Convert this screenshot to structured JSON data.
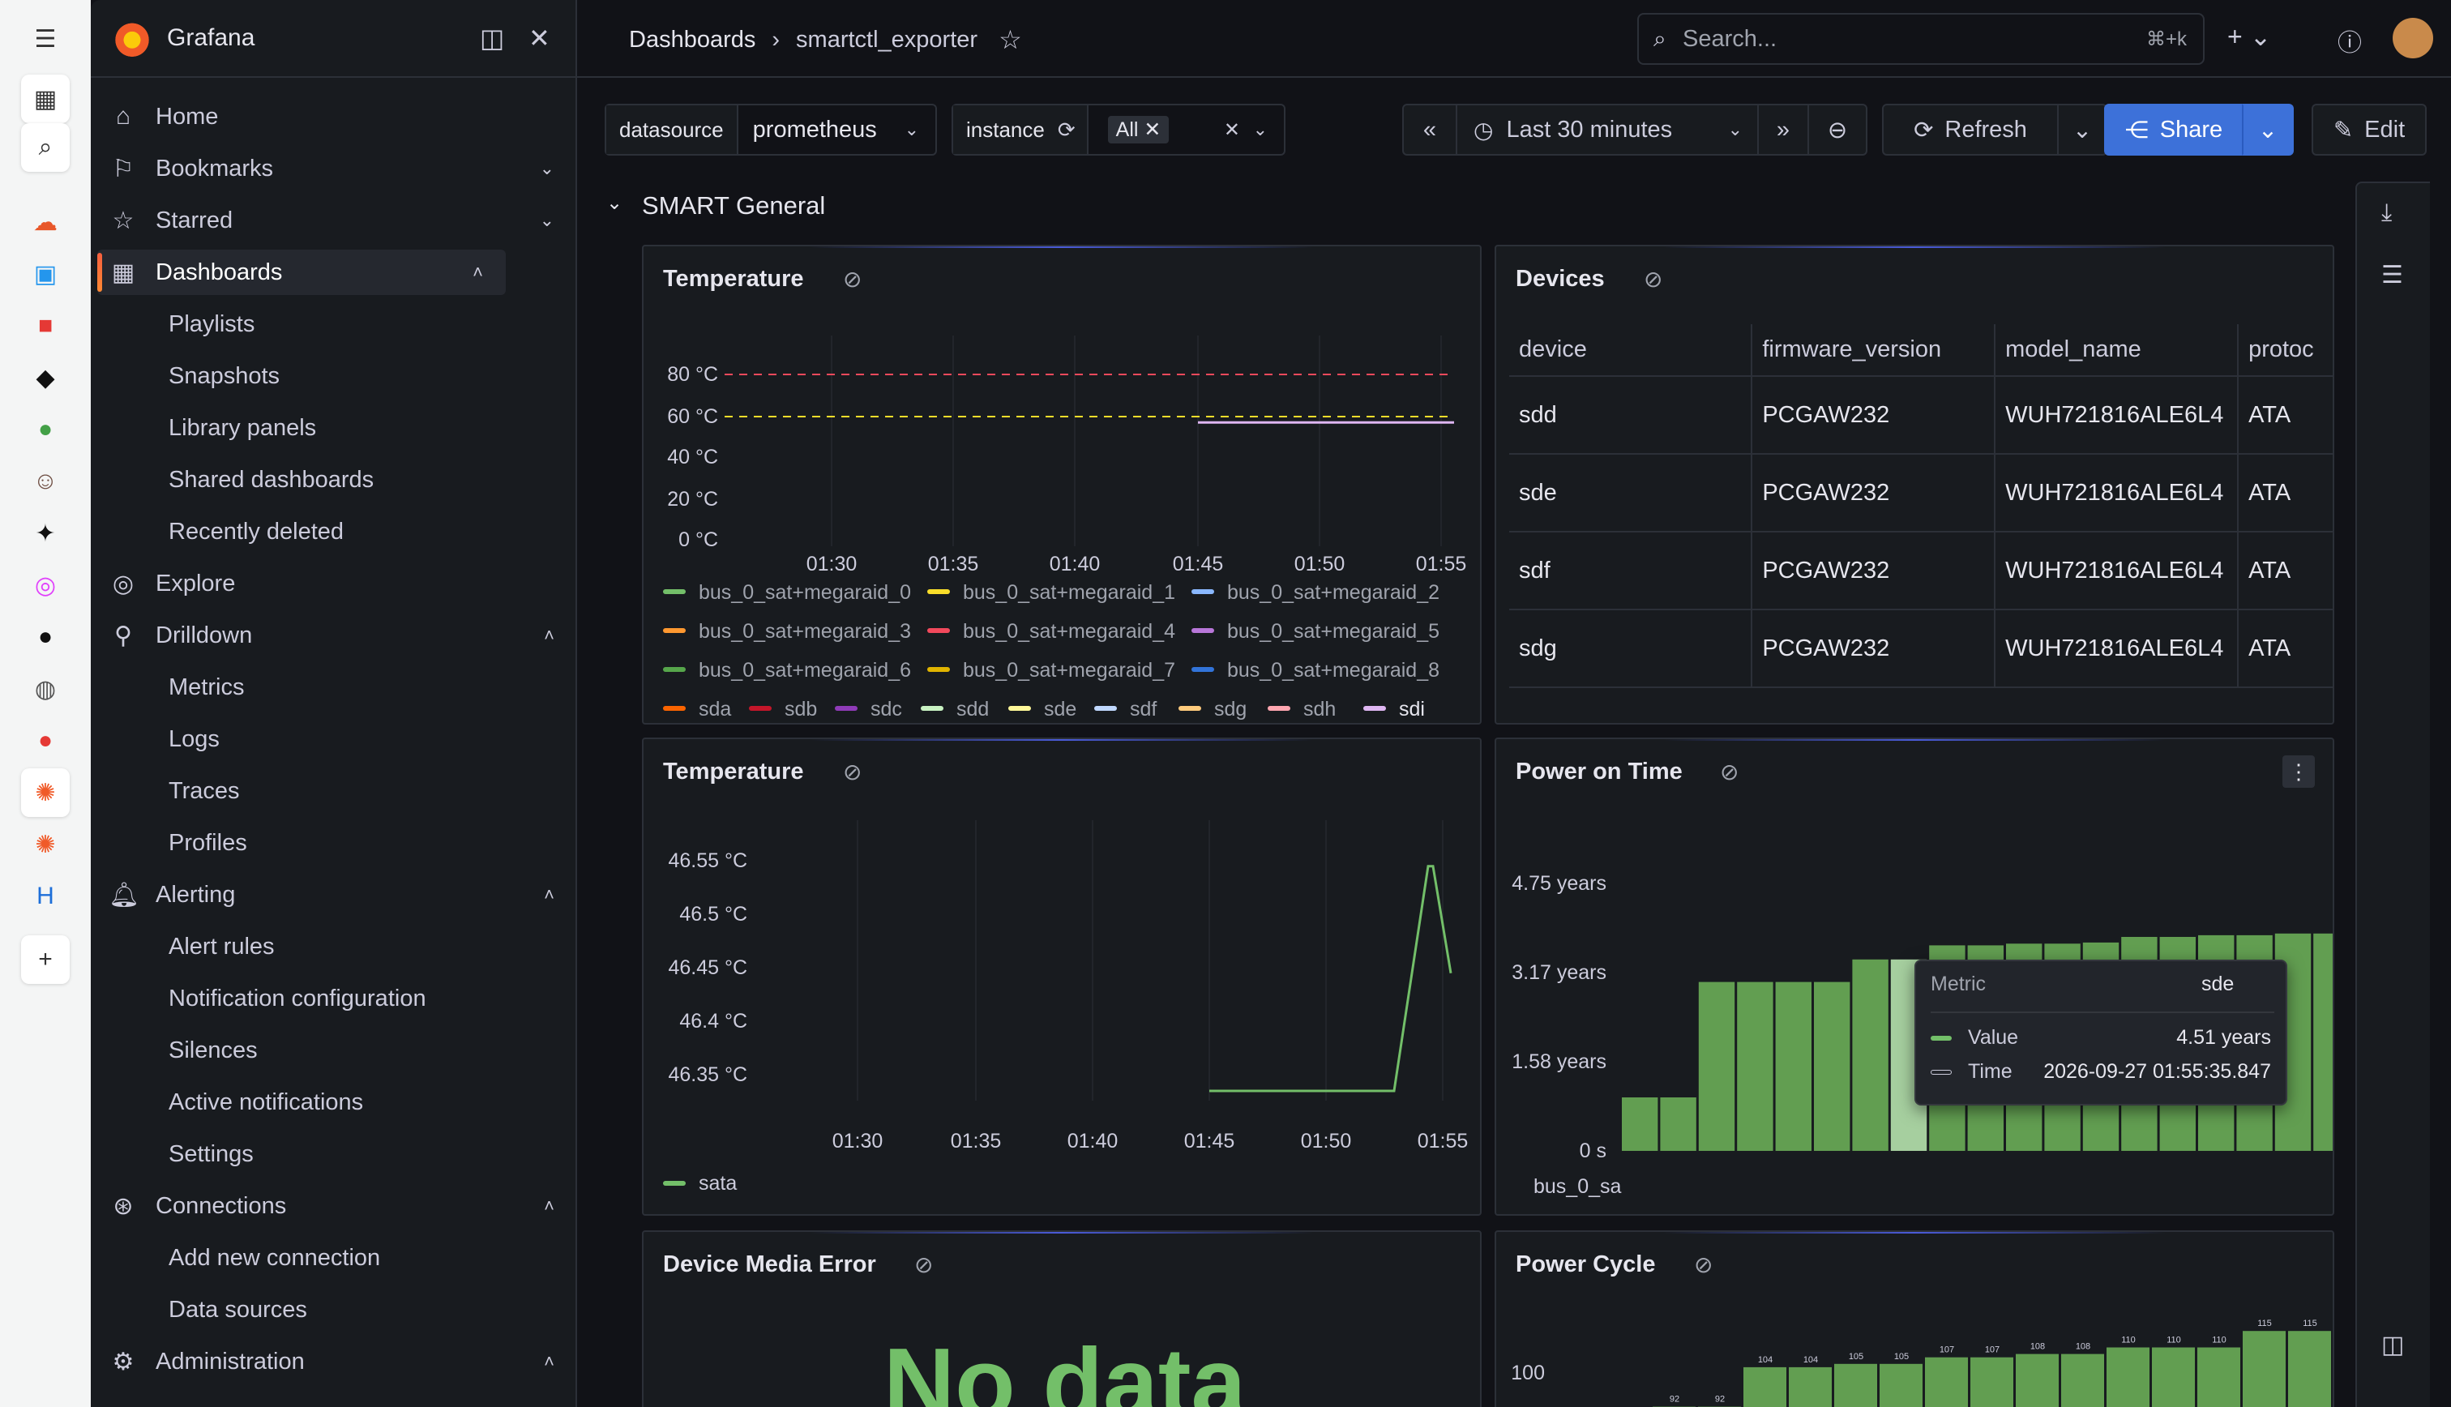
{
  "sidebar": {
    "brand": "Grafana",
    "items": [
      {
        "label": "Home",
        "icon": "home-icon"
      },
      {
        "label": "Bookmarks",
        "icon": "bookmark-icon"
      },
      {
        "label": "Starred",
        "icon": "star-icon"
      },
      {
        "label": "Dashboards",
        "icon": "dashboards-icon"
      },
      {
        "label": "Playlists"
      },
      {
        "label": "Snapshots"
      },
      {
        "label": "Library panels"
      },
      {
        "label": "Shared dashboards"
      },
      {
        "label": "Recently deleted"
      },
      {
        "label": "Explore",
        "icon": "compass-icon"
      },
      {
        "label": "Drilldown",
        "icon": "drilldown-icon"
      },
      {
        "label": "Metrics"
      },
      {
        "label": "Logs"
      },
      {
        "label": "Traces"
      },
      {
        "label": "Profiles"
      },
      {
        "label": "Alerting",
        "icon": "bell-icon"
      },
      {
        "label": "Alert rules"
      },
      {
        "label": "Notification configuration"
      },
      {
        "label": "Silences"
      },
      {
        "label": "Active notifications"
      },
      {
        "label": "Settings"
      },
      {
        "label": "Connections",
        "icon": "connections-icon"
      },
      {
        "label": "Add new connection"
      },
      {
        "label": "Data sources"
      },
      {
        "label": "Administration",
        "icon": "gear-icon"
      }
    ]
  },
  "topbar": {
    "breadcrumb_root": "Dashboards",
    "breadcrumb_sep": "›",
    "breadcrumb_current": "smartctl_exporter",
    "search_placeholder": "Search...",
    "search_shortcut": "⌘+k"
  },
  "controls": {
    "datasource_label": "datasource",
    "datasource_value": "prometheus",
    "instance_label": "instance",
    "instance_value": "All",
    "time_range": "Last 30 minutes",
    "refresh_label": "Refresh",
    "share_label": "Share",
    "edit_label": "Edit"
  },
  "row": {
    "title": "SMART General"
  },
  "panels": {
    "temperature1": {
      "title": "Temperature",
      "y_ticks": [
        "80 °C",
        "60 °C",
        "40 °C",
        "20 °C",
        "0 °C"
      ],
      "x_ticks": [
        "01:30",
        "01:35",
        "01:40",
        "01:45",
        "01:50",
        "01:55"
      ],
      "thresholds": [
        {
          "value": 80,
          "color": "#f2495c"
        },
        {
          "value": 60,
          "color": "#fade2a"
        }
      ],
      "legend": [
        {
          "name": "bus_0_sat+megaraid_0",
          "color": "#73bf69"
        },
        {
          "name": "bus_0_sat+megaraid_1",
          "color": "#fade2a"
        },
        {
          "name": "bus_0_sat+megaraid_2",
          "color": "#8ab8ff"
        },
        {
          "name": "bus_0_sat+megaraid_3",
          "color": "#ff9830"
        },
        {
          "name": "bus_0_sat+megaraid_4",
          "color": "#f2495c"
        },
        {
          "name": "bus_0_sat+megaraid_5",
          "color": "#b877d9"
        },
        {
          "name": "bus_0_sat+megaraid_6",
          "color": "#56a64b"
        },
        {
          "name": "bus_0_sat+megaraid_7",
          "color": "#e0b400"
        },
        {
          "name": "bus_0_sat+megaraid_8",
          "color": "#3274d9"
        },
        {
          "name": "sda",
          "color": "#fa6400"
        },
        {
          "name": "sdb",
          "color": "#c4162a"
        },
        {
          "name": "sdc",
          "color": "#8f3bb8"
        },
        {
          "name": "sdd",
          "color": "#c8f2c2"
        },
        {
          "name": "sde",
          "color": "#fff899"
        },
        {
          "name": "sdf",
          "color": "#c0d8ff"
        },
        {
          "name": "sdg",
          "color": "#ffcb7d"
        },
        {
          "name": "sdh",
          "color": "#ffa6b0"
        },
        {
          "name": "sdi",
          "color": "#deb6f2"
        }
      ]
    },
    "devices": {
      "title": "Devices",
      "columns": [
        "device",
        "firmware_version",
        "model_name",
        "protoc"
      ],
      "rows": [
        [
          "sdd",
          "PCGAW232",
          "WUH721816ALE6L4",
          "ATA"
        ],
        [
          "sde",
          "PCGAW232",
          "WUH721816ALE6L4",
          "ATA"
        ],
        [
          "sdf",
          "PCGAW232",
          "WUH721816ALE6L4",
          "ATA"
        ],
        [
          "sdg",
          "PCGAW232",
          "WUH721816ALE6L4",
          "ATA"
        ]
      ]
    },
    "temperature2": {
      "title": "Temperature",
      "y_ticks": [
        "46.55 °C",
        "46.5 °C",
        "46.45 °C",
        "46.4 °C",
        "46.35 °C"
      ],
      "x_ticks": [
        "01:30",
        "01:35",
        "01:40",
        "01:45",
        "01:50",
        "01:55"
      ],
      "legend": [
        {
          "name": "sata",
          "color": "#73bf69"
        }
      ]
    },
    "power_on": {
      "title": "Power on Time",
      "y_ticks": [
        "4.75 years",
        "3.17 years",
        "1.58 years",
        "0 s"
      ],
      "x_label_visible": "bus_0_sa",
      "tooltip": {
        "header": "Metric",
        "metric": "sde",
        "value_label": "Value",
        "value": "4.51 years",
        "time_label": "Time",
        "time": "2026-09-27 01:55:35.847"
      }
    },
    "media_error": {
      "title": "Device Media Error",
      "no_data": "No data"
    },
    "power_cycle": {
      "title": "Power Cycle",
      "y_tick": "100"
    }
  },
  "chart_data": [
    {
      "type": "line",
      "title": "Temperature",
      "x": [
        "01:45",
        "01:47",
        "01:50",
        "01:52",
        "01:55"
      ],
      "series": [
        {
          "name": "sdi",
          "values": [
            45,
            45,
            45,
            45,
            45
          ]
        }
      ],
      "ylim": [
        0,
        90
      ]
    },
    {
      "type": "line",
      "title": "Temperature",
      "x": [
        "01:45",
        "01:50",
        "01:53",
        "01:54",
        "01:55",
        "01:55"
      ],
      "series": [
        {
          "name": "sata",
          "values": [
            46.35,
            46.35,
            46.35,
            46.56,
            46.56,
            46.46
          ]
        }
      ],
      "ylim": [
        46.32,
        46.57
      ]
    },
    {
      "type": "bar",
      "title": "Power on Time",
      "values": [
        0.95,
        0.95,
        3.0,
        3.0,
        3.0,
        3.0,
        3.4,
        3.4,
        3.65,
        3.65,
        3.68,
        3.68,
        3.7,
        3.8,
        3.8,
        3.83,
        3.83,
        3.86,
        3.86
      ],
      "highlight_index": 7,
      "ylim": [
        0,
        4.75
      ]
    },
    {
      "type": "bar",
      "title": "Power Cycle",
      "values": [
        92,
        92,
        104,
        104,
        105,
        105,
        107,
        107,
        108,
        108,
        110,
        110,
        110,
        115,
        115
      ],
      "data_labels": [
        "92",
        "92",
        "104",
        "104",
        "105",
        "105",
        "107",
        "107",
        "108",
        "108",
        "110",
        "110",
        "110",
        "115",
        "115"
      ],
      "ylim": [
        86,
        118
      ]
    }
  ]
}
